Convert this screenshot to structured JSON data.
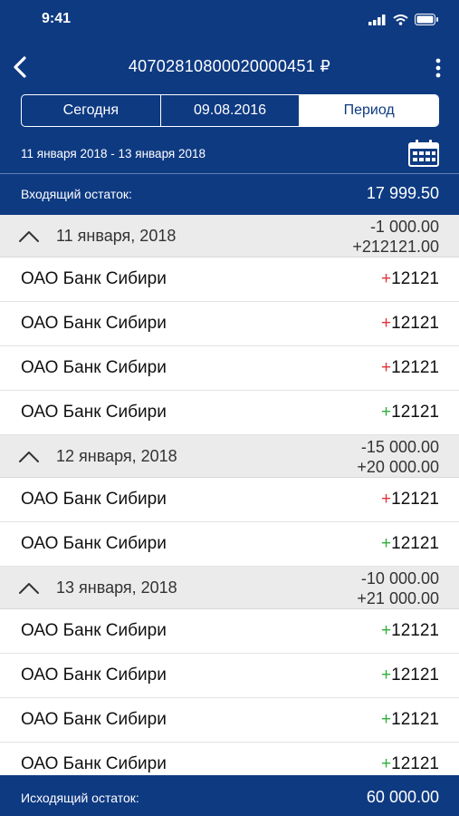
{
  "status_bar": {
    "time": "9:41"
  },
  "header": {
    "account": "40702810800020000451 ₽",
    "segments": [
      {
        "label": "Сегодня",
        "active": false
      },
      {
        "label": "09.08.2016",
        "active": false
      },
      {
        "label": "Период",
        "active": true
      }
    ],
    "period_text": "11 января 2018 - 13 января 2018",
    "incoming_label": "Входящий остаток:",
    "incoming_value": "17 999.50"
  },
  "groups": [
    {
      "date": "11 января, 2018",
      "debit": "-1 000.00",
      "credit": "+212121.00",
      "rows": [
        {
          "name": "ОАО Банк Сибири",
          "sign": "+",
          "amount": "12121",
          "color": "#e0323a"
        },
        {
          "name": "ОАО Банк Сибири",
          "sign": "+",
          "amount": "12121",
          "color": "#e0323a"
        },
        {
          "name": "ОАО Банк Сибири",
          "sign": "+",
          "amount": "12121",
          "color": "#e0323a"
        },
        {
          "name": "ОАО Банк Сибири",
          "sign": "+",
          "amount": "12121",
          "color": "#2fae3b"
        }
      ]
    },
    {
      "date": "12 января, 2018",
      "debit": "-15 000.00",
      "credit": "+20 000.00",
      "rows": [
        {
          "name": "ОАО Банк Сибири",
          "sign": "+",
          "amount": "12121",
          "color": "#e0323a"
        },
        {
          "name": "ОАО Банк Сибири",
          "sign": "+",
          "amount": "12121",
          "color": "#2fae3b"
        }
      ]
    },
    {
      "date": "13 января, 2018",
      "debit": "-10 000.00",
      "credit": "+21 000.00",
      "rows": [
        {
          "name": "ОАО Банк Сибири",
          "sign": "+",
          "amount": "12121",
          "color": "#2fae3b"
        },
        {
          "name": "ОАО Банк Сибири",
          "sign": "+",
          "amount": "12121",
          "color": "#2fae3b"
        },
        {
          "name": "ОАО Банк Сибири",
          "sign": "+",
          "amount": "12121",
          "color": "#2fae3b"
        },
        {
          "name": "ОАО Банк Сибири",
          "sign": "+",
          "amount": "12121",
          "color": "#2fae3b"
        }
      ]
    }
  ],
  "footer": {
    "outgoing_label": "Исходящий остаток:",
    "outgoing_value": "60 000.00"
  },
  "colors": {
    "brand": "#0e3a82",
    "debit_sign": "#e0323a",
    "credit_sign": "#2fae3b",
    "group_bg": "#ebebeb"
  },
  "icons": [
    "back-icon",
    "more-icon",
    "calendar-icon",
    "chevron-up-icon",
    "signal-icon",
    "wifi-icon",
    "battery-icon"
  ]
}
